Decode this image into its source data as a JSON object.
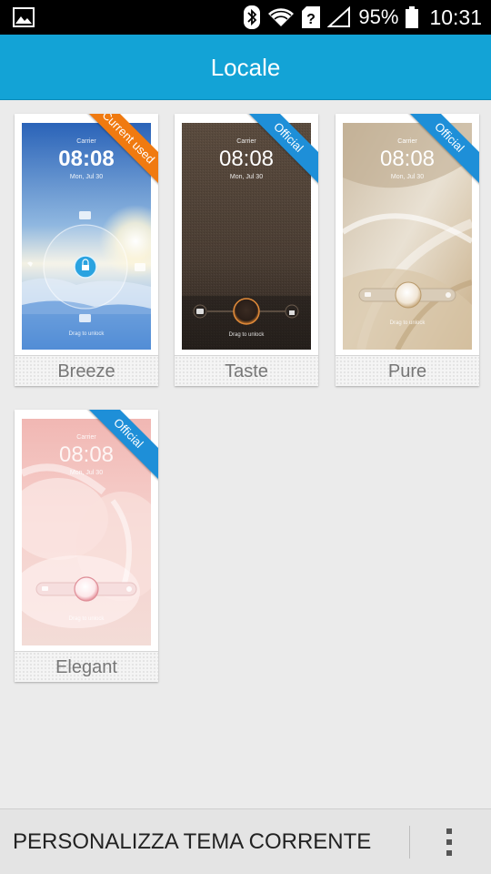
{
  "status_bar": {
    "battery": "95%",
    "time": "10:31",
    "icons": [
      "gallery-icon",
      "bluetooth-icon",
      "wifi-icon",
      "sim-unknown-icon",
      "signal-icon",
      "battery-icon"
    ]
  },
  "app_bar": {
    "title": "Locale"
  },
  "themes": [
    {
      "label": "Breeze",
      "ribbon": "Current used",
      "ribbon_color": "#f07a10",
      "lockscreen": {
        "carrier": "Carrier",
        "clock": "08:08",
        "date": "Mon, Jul 30",
        "hint": "Drag to unlock"
      }
    },
    {
      "label": "Taste",
      "ribbon": "Official",
      "ribbon_color": "#1e8fd8",
      "lockscreen": {
        "carrier": "Carrier",
        "clock": "08:08",
        "date": "Mon, Jul 30",
        "hint": "Drag to unlock"
      }
    },
    {
      "label": "Pure",
      "ribbon": "Official",
      "ribbon_color": "#1e8fd8",
      "lockscreen": {
        "carrier": "Carrier",
        "clock": "08:08",
        "date": "Mon, Jul 30",
        "hint": "Drag to unlock"
      }
    },
    {
      "label": "Elegant",
      "ribbon": "Official",
      "ribbon_color": "#1e8fd8",
      "lockscreen": {
        "carrier": "Carrier",
        "clock": "08:08",
        "date": "Mon, Jul 30",
        "hint": "Drag to unlock"
      }
    }
  ],
  "bottom_bar": {
    "action_label": "PERSONALIZZA TEMA CORRENTE",
    "overflow_icon": "overflow-menu-icon"
  },
  "colors": {
    "accent": "#13a3d6",
    "ribbon_current": "#f07a10",
    "ribbon_official": "#1e8fd8"
  }
}
